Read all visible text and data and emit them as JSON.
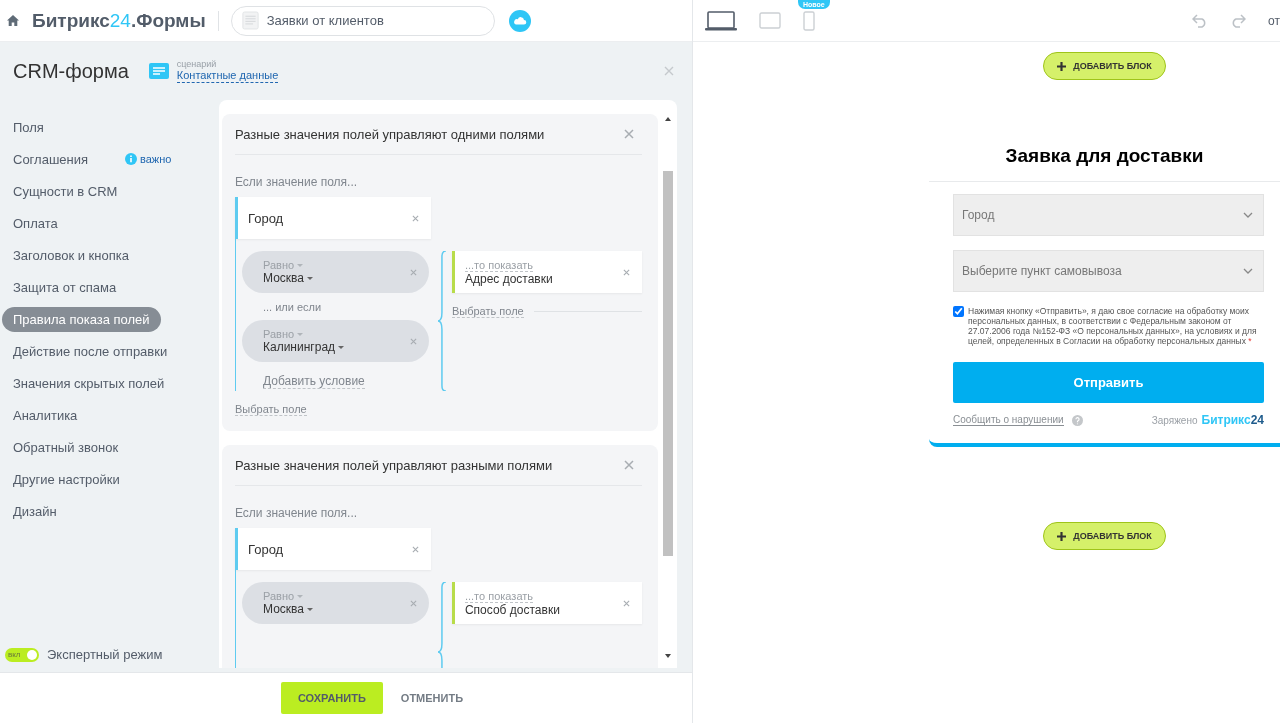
{
  "topbar": {
    "logo": [
      {
        "text": "Битрикс",
        "accent": false
      },
      {
        "text": "24",
        "accent": true
      },
      {
        "text": ".Формы",
        "accent": false
      }
    ],
    "search": {
      "value": "Заявки от клиентов"
    },
    "devices": [
      {
        "kind": "laptop",
        "selected": true
      },
      {
        "kind": "tablet",
        "selected": false
      },
      {
        "kind": "phone",
        "selected": false,
        "badge": "Новое"
      }
    ],
    "cut_text": "от"
  },
  "panel": {
    "title": "CRM-форма",
    "scenario_caption": "сценарий",
    "scenario_link": "Контактные данные"
  },
  "sidebar": {
    "items": [
      {
        "label": "Поля",
        "selected": false
      },
      {
        "label": "Соглашения",
        "selected": false,
        "note": "важно"
      },
      {
        "label": "Сущности в CRM",
        "selected": false
      },
      {
        "label": "Оплата",
        "selected": false
      },
      {
        "label": "Заголовок и кнопка",
        "selected": false
      },
      {
        "label": "Защита от спама",
        "selected": false
      },
      {
        "label": "Правила показа полей",
        "selected": true
      },
      {
        "label": "Действие после отправки",
        "selected": false
      },
      {
        "label": "Значения скрытых полей",
        "selected": false
      },
      {
        "label": "Аналитика",
        "selected": false
      },
      {
        "label": "Обратный звонок",
        "selected": false
      },
      {
        "label": "Другие настройки",
        "selected": false
      },
      {
        "label": "Дизайн",
        "selected": false
      }
    ],
    "expert_mode": {
      "label": "Экспертный режим",
      "on": true,
      "toggle_text": "вкл"
    }
  },
  "rules": [
    {
      "title": "Разные значения полей управляют одними полями",
      "if_label": "Если значение поля...",
      "field": "Город",
      "conditions": [
        {
          "operator": "Равно",
          "value": "Москва"
        },
        {
          "operator": "Равно",
          "value": "Калининград"
        }
      ],
      "or_label": "... или если",
      "add_condition": "Добавить условие",
      "actions": [
        {
          "label": "...то показать",
          "field": "Адрес доставки"
        }
      ],
      "action_pick_field": "Выбрать поле",
      "pick_field": "Выбрать поле"
    },
    {
      "title": "Разные значения полей управляют разными полями",
      "if_label": "Если значение поля...",
      "field": "Город",
      "conditions": [
        {
          "operator": "Равно",
          "value": "Москва"
        }
      ],
      "actions": [
        {
          "label": "...то показать",
          "field": "Способ доставки"
        }
      ]
    }
  ],
  "footer": {
    "save": "СОХРАНИТЬ",
    "cancel": "ОТМЕНИТЬ"
  },
  "preview": {
    "add_block_top": "ДОБАВИТЬ БЛОК",
    "add_block_bottom": "ДОБАВИТЬ БЛОК",
    "form": {
      "title": "Заявка для доставки",
      "selects": [
        {
          "placeholder": "Город"
        },
        {
          "placeholder": "Выберите пункт самовывоза"
        }
      ],
      "consent": {
        "checked": true,
        "text": "Нажимая кнопку «Отправить», я даю свое согласие на обработку моих персональных данных, в соответствии с Федеральным законом от 27.07.2006 года №152-ФЗ «О персональных данных», на условиях и для целей, определенных в Согласии на обработку персональных данных",
        "required_mark": "*"
      },
      "submit": "Отправить",
      "report_link": "Сообщить о нарушении",
      "powered_by": "Заряжено",
      "brand": [
        {
          "text": "Битрикс",
          "accent": false
        },
        {
          "text": "24",
          "accent": true
        }
      ]
    }
  }
}
